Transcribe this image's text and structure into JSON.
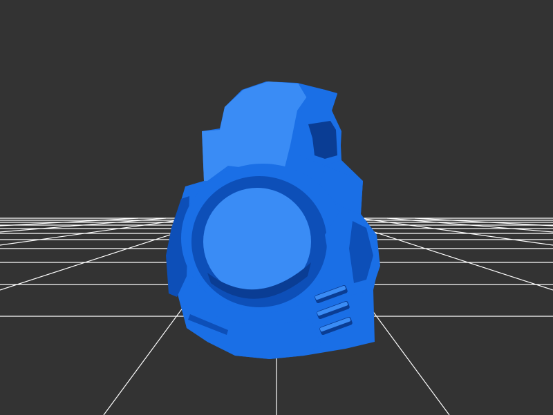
{
  "viewer": {
    "background_color": "#333333",
    "grid_color": "#ffffff",
    "model_color": "#1a6fe6",
    "model_highlight": "#3a8cf5",
    "model_shadow": "#0d4fb8",
    "model_dark": "#0a3d94",
    "model_name": "armor-shoulder-pad-icon"
  }
}
